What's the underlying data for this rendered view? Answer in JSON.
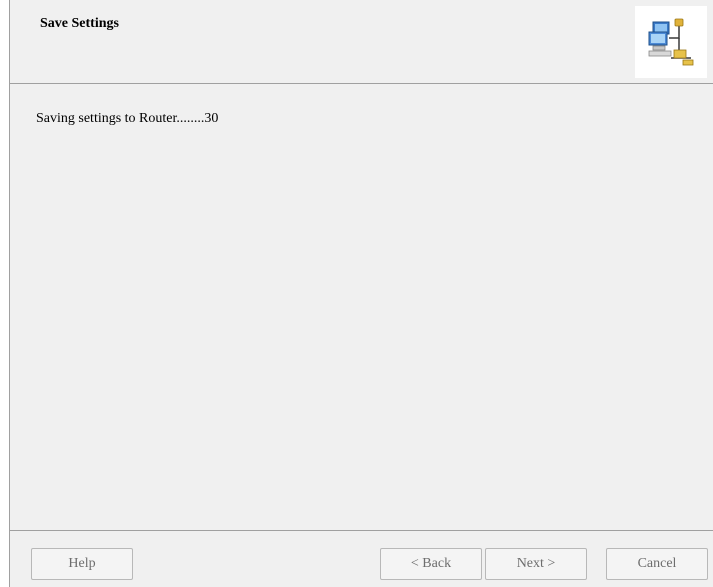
{
  "header": {
    "title": "Save Settings",
    "icon": "network-router-icon"
  },
  "content": {
    "status_text": "Saving settings to Router........30"
  },
  "footer": {
    "help_label": "Help",
    "back_label": "< Back",
    "next_label": "Next >",
    "cancel_label": "Cancel"
  },
  "colors": {
    "panel_bg": "#f0f0f0",
    "border": "#a0a0a0",
    "disabled_text": "#6d6d6d"
  }
}
